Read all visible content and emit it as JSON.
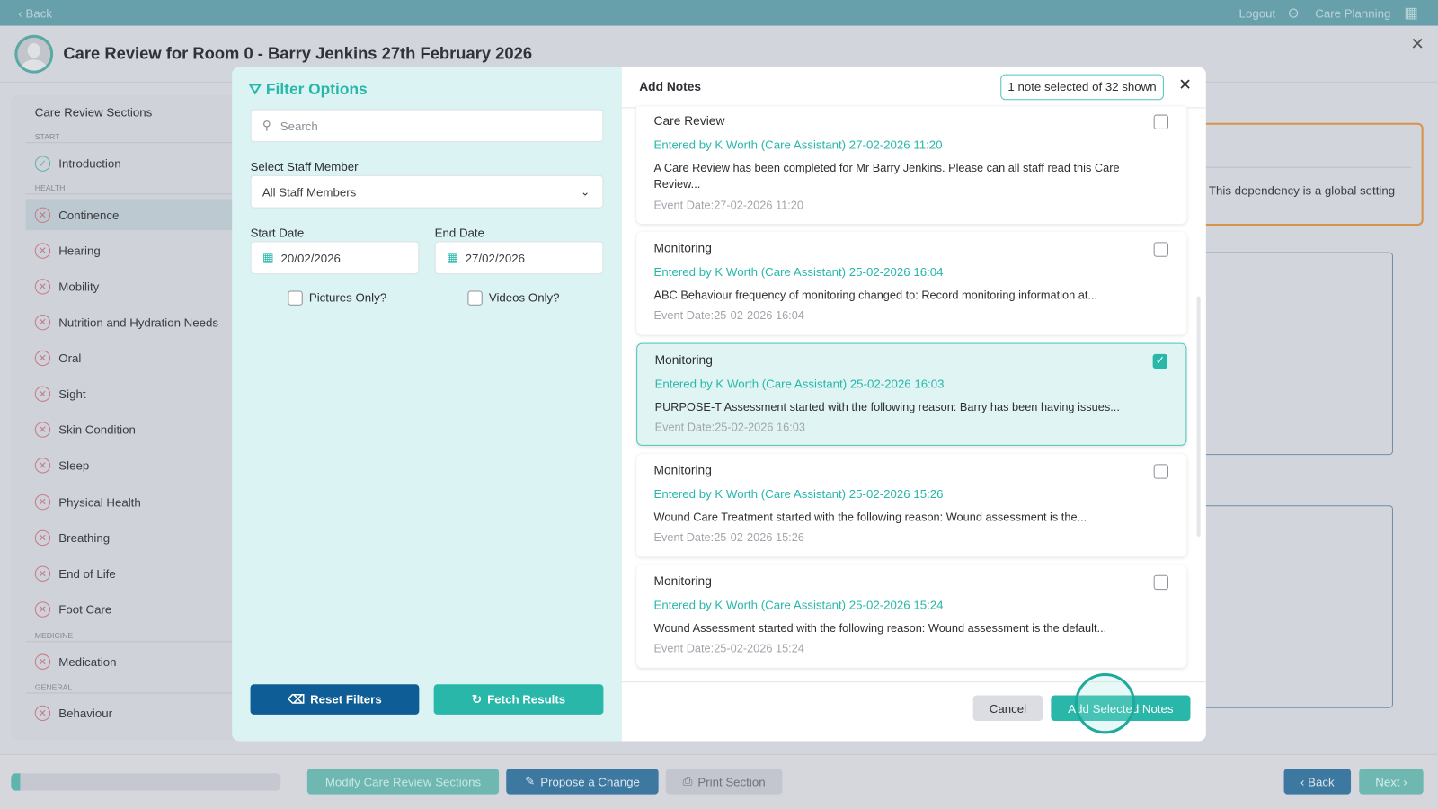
{
  "topbar": {
    "back": "‹ Back",
    "logout": "Logout",
    "app": "Care Planning"
  },
  "header": {
    "title": "Care Review for Room 0 - Barry Jenkins 27th February 2026"
  },
  "sidebar": {
    "title": "Care Review Sections",
    "sections": [
      {
        "label": "START"
      },
      {
        "label": "HEALTH"
      },
      {
        "label": "MEDICINE"
      },
      {
        "label": "GENERAL"
      }
    ],
    "items": [
      {
        "label": "Introduction",
        "status": "complete"
      },
      {
        "label": "Continence",
        "status": "incomplete"
      },
      {
        "label": "Hearing",
        "status": "incomplete"
      },
      {
        "label": "Mobility",
        "status": "incomplete"
      },
      {
        "label": "Nutrition and Hydration Needs",
        "status": "incomplete"
      },
      {
        "label": "Oral",
        "status": "incomplete"
      },
      {
        "label": "Sight",
        "status": "incomplete"
      },
      {
        "label": "Skin Condition",
        "status": "incomplete"
      },
      {
        "label": "Sleep",
        "status": "incomplete"
      },
      {
        "label": "Physical Health",
        "status": "incomplete"
      },
      {
        "label": "Breathing",
        "status": "incomplete"
      },
      {
        "label": "End of Life",
        "status": "incomplete"
      },
      {
        "label": "Foot Care",
        "status": "incomplete"
      },
      {
        "label": "Medication",
        "status": "incomplete"
      },
      {
        "label": "Behaviour",
        "status": "incomplete"
      }
    ]
  },
  "background": {
    "dependency_text": "This dependency is a global setting"
  },
  "filter": {
    "title": "Filter Options",
    "search_placeholder": "Search",
    "staff_label": "Select Staff Member",
    "staff_value": "All Staff Members",
    "start_label": "Start Date",
    "start_value": "20/02/2026",
    "end_label": "End Date",
    "end_value": "27/02/2026",
    "pictures_label": "Pictures Only?",
    "videos_label": "Videos Only?",
    "reset": "Reset Filters",
    "fetch": "Fetch Results"
  },
  "notes": {
    "title": "Add Notes",
    "count_badge": "1 note selected of 32 shown",
    "cancel": "Cancel",
    "add": "Add Selected Notes",
    "items": [
      {
        "type": "Care Review",
        "by": "Entered by K Worth (Care Assistant) 27-02-2026 11:20",
        "body": "A Care Review has been completed for Mr Barry Jenkins. Please can all staff read this Care Review...",
        "event": "Event Date:27-02-2026 11:20",
        "selected": false
      },
      {
        "type": "Monitoring",
        "by": "Entered by K Worth (Care Assistant) 25-02-2026 16:04",
        "body": "ABC Behaviour frequency of monitoring changed to: Record monitoring information at...",
        "event": "Event Date:25-02-2026 16:04",
        "selected": false
      },
      {
        "type": "Monitoring",
        "by": "Entered by K Worth (Care Assistant) 25-02-2026 16:03",
        "body": "PURPOSE-T Assessment started with the following reason: Barry has been having issues...",
        "event": "Event Date:25-02-2026 16:03",
        "selected": true
      },
      {
        "type": "Monitoring",
        "by": "Entered by K Worth (Care Assistant) 25-02-2026 15:26",
        "body": "Wound Care Treatment started with the following reason: Wound assessment is the...",
        "event": "Event Date:25-02-2026 15:26",
        "selected": false
      },
      {
        "type": "Monitoring",
        "by": "Entered by K Worth (Care Assistant) 25-02-2026 15:24",
        "body": "Wound Assessment started with the following reason: Wound assessment is the default...",
        "event": "Event Date:25-02-2026 15:24",
        "selected": false
      }
    ]
  },
  "footer": {
    "modify": "Modify Care Review Sections",
    "propose": "Propose a Change",
    "print": "Print Section",
    "back": "‹ Back",
    "next": "Next ›",
    "progress_percent": 2
  },
  "colors": {
    "accent": "#28b7a9",
    "topbar": "#67a0aa",
    "reset": "#0f5d96",
    "warning": "#d7934a"
  }
}
